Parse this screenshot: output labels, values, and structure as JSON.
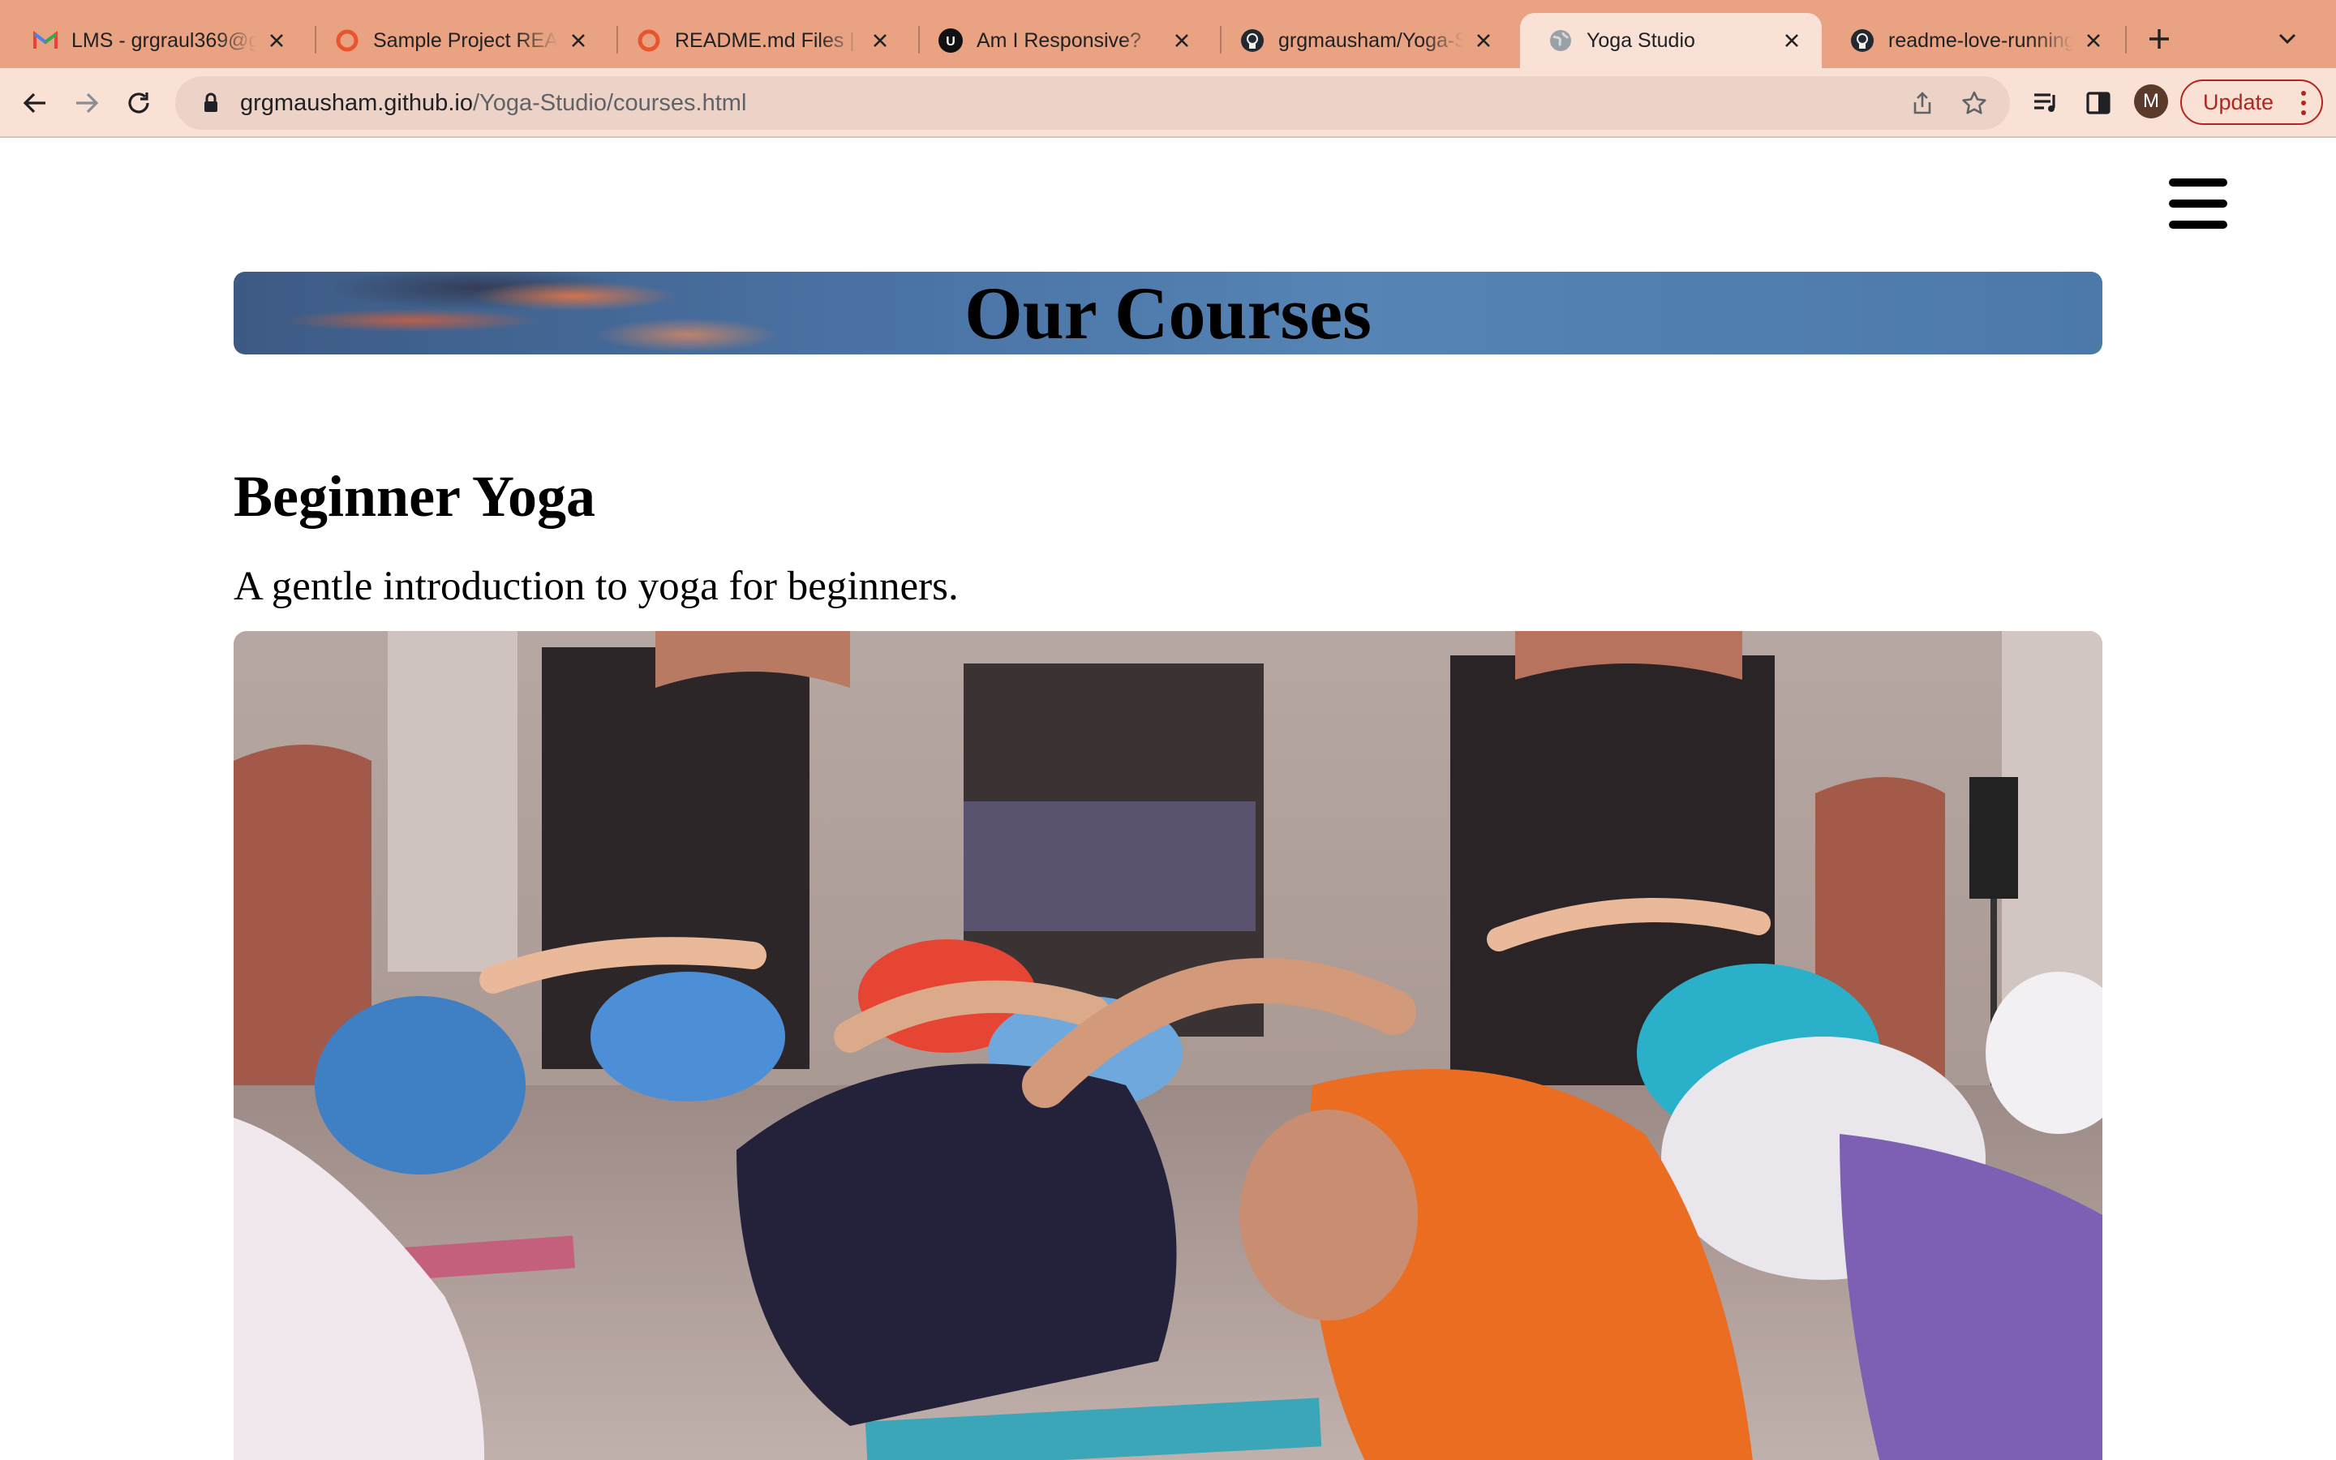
{
  "browser": {
    "tabs": [
      {
        "title": "LMS - grgraul369@g",
        "icon": "gmail-icon",
        "active": false
      },
      {
        "title": "Sample Project REAL",
        "icon": "readme-site-icon",
        "active": false
      },
      {
        "title": "README.md Files | M",
        "icon": "readme-site-icon",
        "active": false
      },
      {
        "title": "Am I Responsive?",
        "icon": "amiresponsive-icon",
        "active": false
      },
      {
        "title": "grgmausham/Yoga-S",
        "icon": "github-icon",
        "active": false
      },
      {
        "title": "Yoga Studio",
        "icon": "globe-icon",
        "active": true
      },
      {
        "title": "readme-love-running",
        "icon": "github-icon",
        "active": false
      }
    ],
    "address": {
      "host": "grgmausham.github.io",
      "path": "/Yoga-Studio/courses.html"
    },
    "avatar_letter": "M",
    "update_label": "Update",
    "colors": {
      "tabstrip": "#e9a383",
      "toolbar": "#f9e1d6",
      "update": "#b3261e"
    }
  },
  "page": {
    "banner_title": "Our Courses",
    "courses": [
      {
        "title": "Beginner Yoga",
        "description": "A gentle introduction to yoga for beginners.",
        "image": "group-yoga-class-photo"
      }
    ]
  }
}
